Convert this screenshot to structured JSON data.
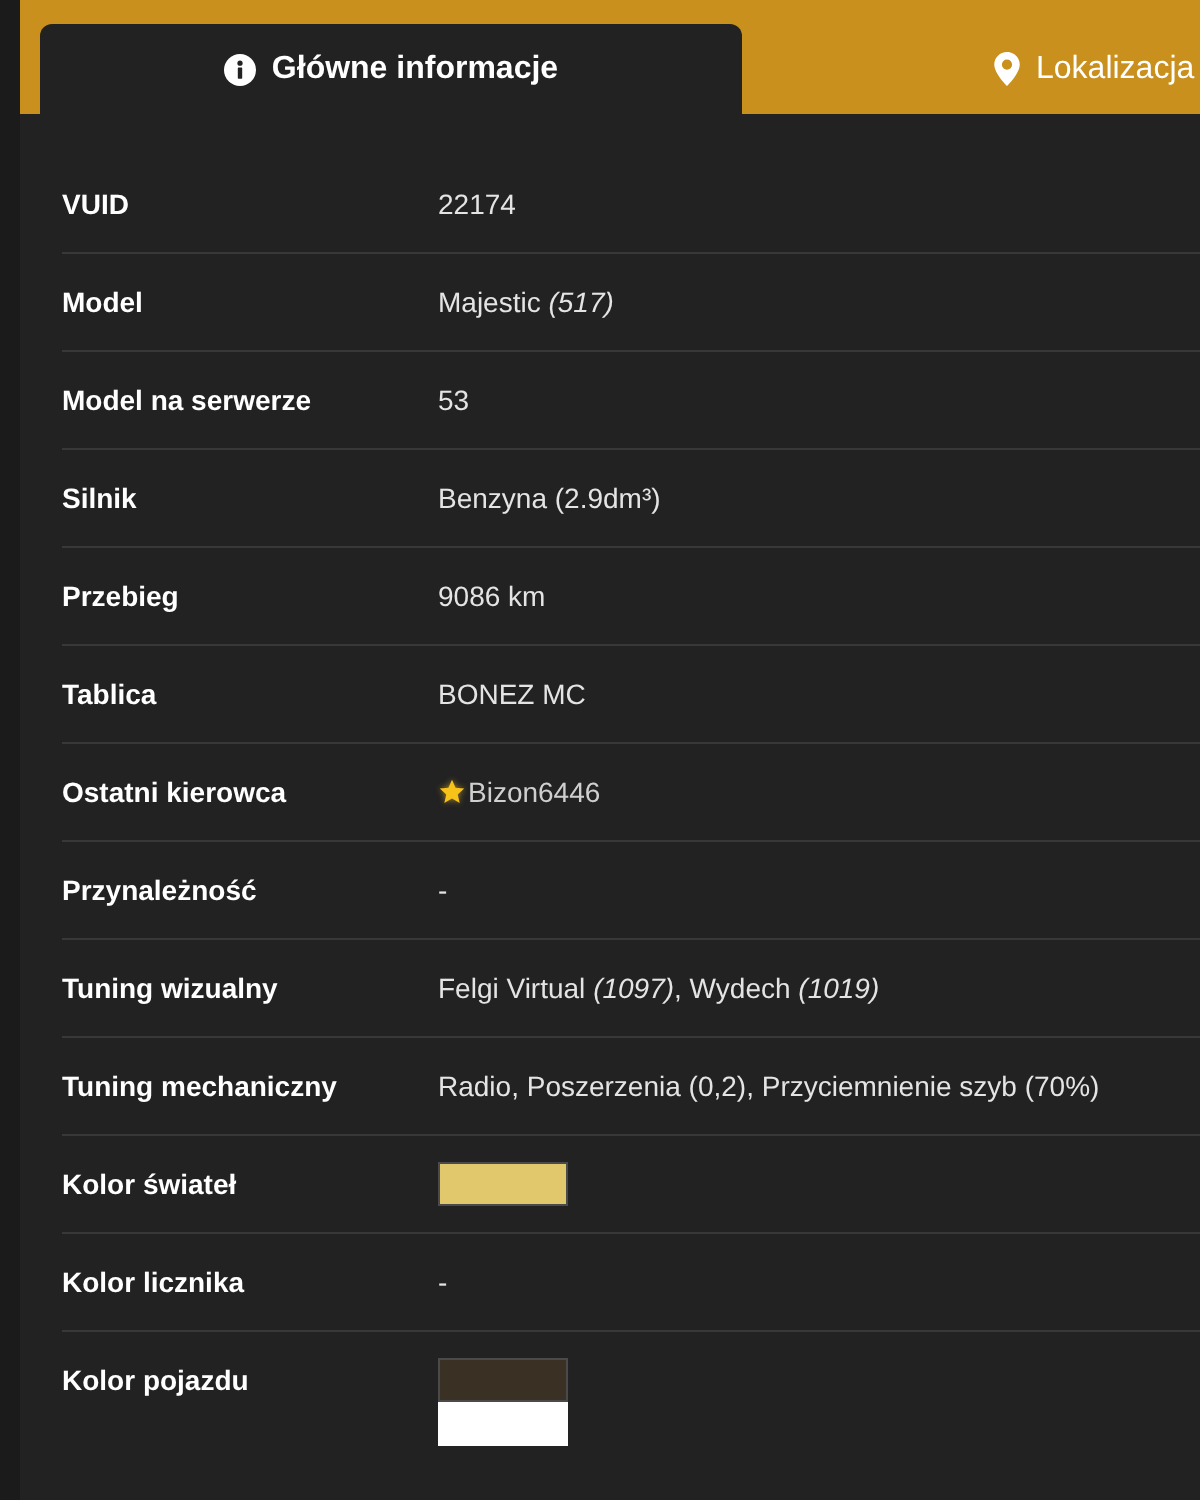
{
  "tabs": [
    {
      "label": "Główne informacje",
      "kind": "info",
      "selected": true
    },
    {
      "label": "Lokalizacja",
      "kind": "location",
      "selected": false
    }
  ],
  "rows": [
    {
      "label": "VUID",
      "kind": "text",
      "value": "22174"
    },
    {
      "label": "Model",
      "kind": "text",
      "value": "Majestic *(517)*"
    },
    {
      "label": "Model na serwerze",
      "kind": "text",
      "value": "53"
    },
    {
      "label": "Silnik",
      "kind": "text",
      "value": "Benzyna (2.9dm³)"
    },
    {
      "label": "Przebieg",
      "kind": "text",
      "value": "9086 km"
    },
    {
      "label": "Tablica",
      "kind": "text",
      "value": "BONEZ MC"
    },
    {
      "label": "Ostatni kierowca",
      "kind": "driver",
      "value": "Bizon6446"
    },
    {
      "label": "Przynależność",
      "kind": "text",
      "value": "-"
    },
    {
      "label": "Tuning wizualny",
      "kind": "text",
      "value": "Felgi Virtual *(1097)*, Wydech *(1019)*"
    },
    {
      "label": "Tuning mechaniczny",
      "kind": "text",
      "value": "Radio, Poszerzenia (0,2), Przyciemnienie szyb (70%)"
    },
    {
      "label": "Kolor świateł",
      "kind": "swatch",
      "swatches": [
        {
          "color": "#e2c86c"
        }
      ]
    },
    {
      "label": "Kolor licznika",
      "kind": "text",
      "value": "-"
    },
    {
      "label": "Kolor pojazdu",
      "kind": "swatch",
      "swatches": [
        {
          "color": "#3a3024"
        },
        {
          "color": "#ffffff"
        }
      ]
    }
  ]
}
